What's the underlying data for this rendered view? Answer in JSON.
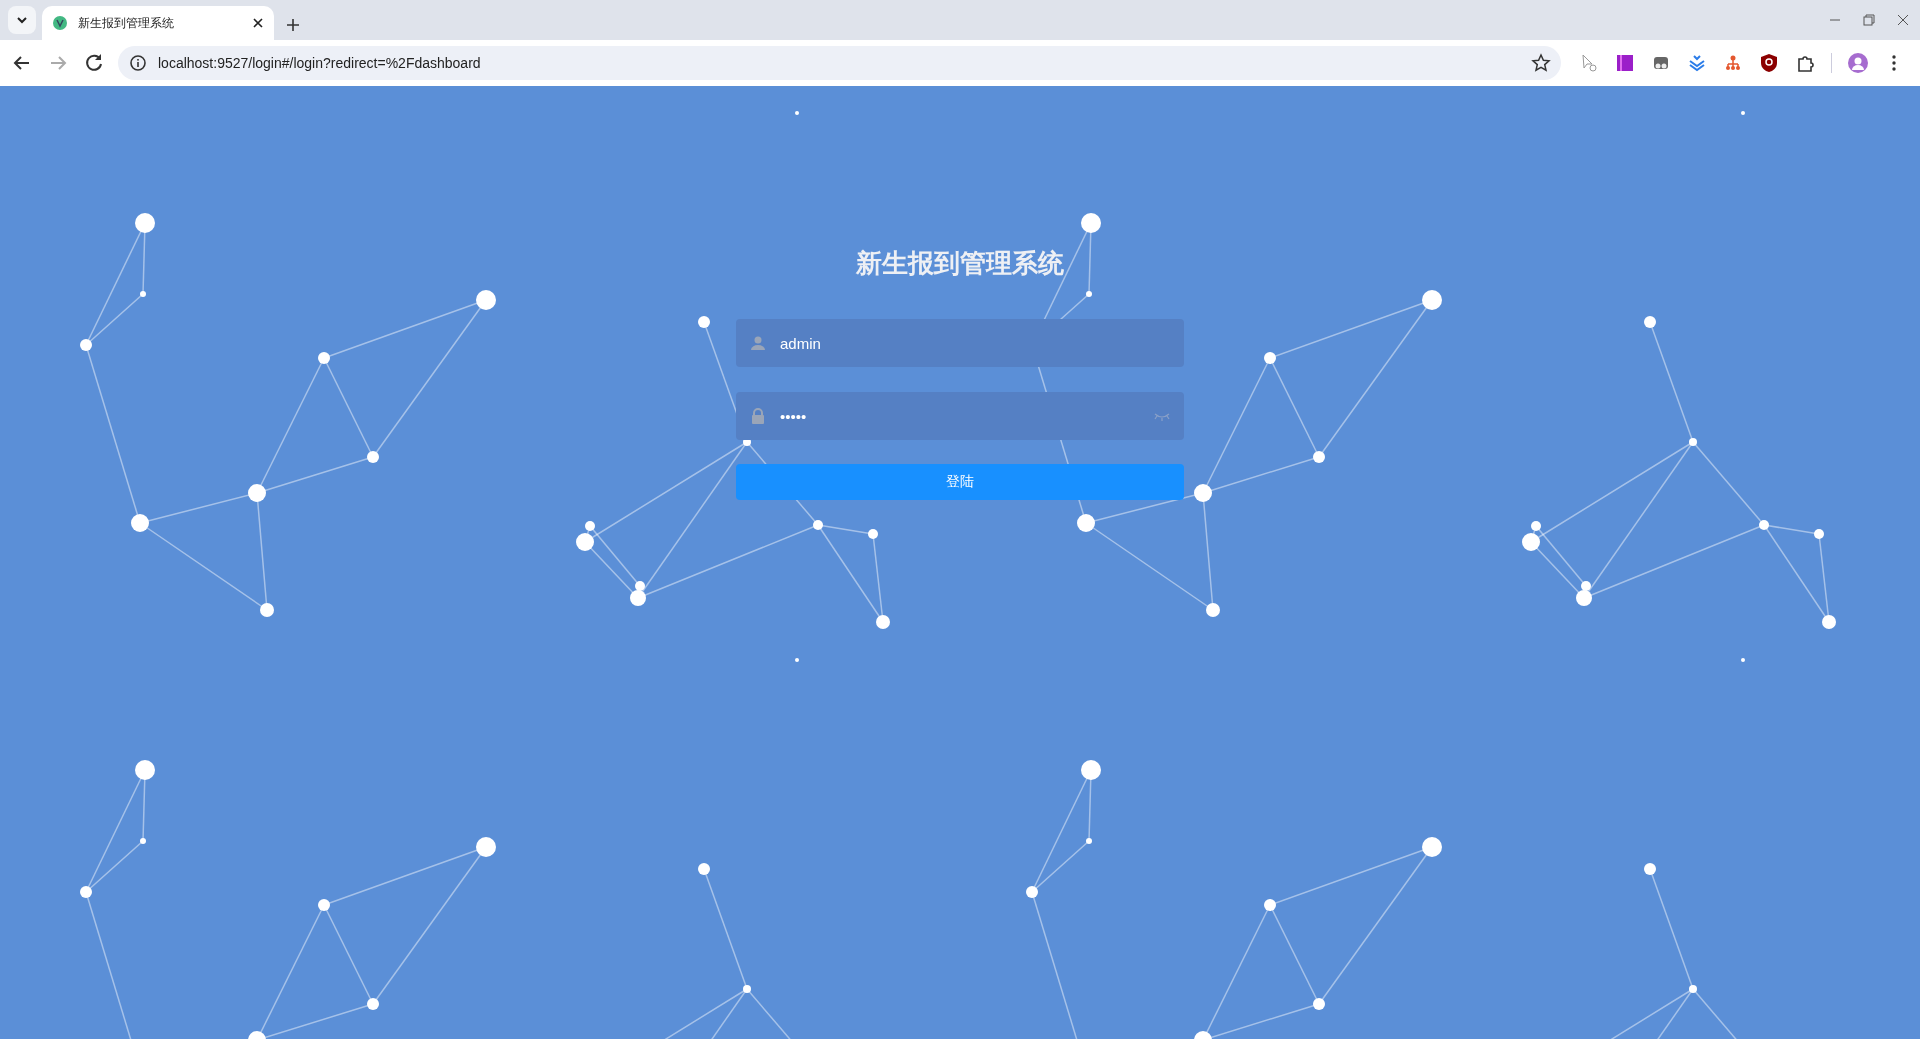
{
  "browser": {
    "tabs": [
      {
        "title": "新生报到管理系统",
        "selected": true
      }
    ],
    "address": "localhost:9527/login#/login?redirect=%2Fdashboard"
  },
  "login": {
    "title": "新生报到管理系统",
    "fields": [
      {
        "kind": "username",
        "value": "admin"
      },
      {
        "kind": "password",
        "value": "•••••"
      }
    ],
    "button": "登陆"
  }
}
